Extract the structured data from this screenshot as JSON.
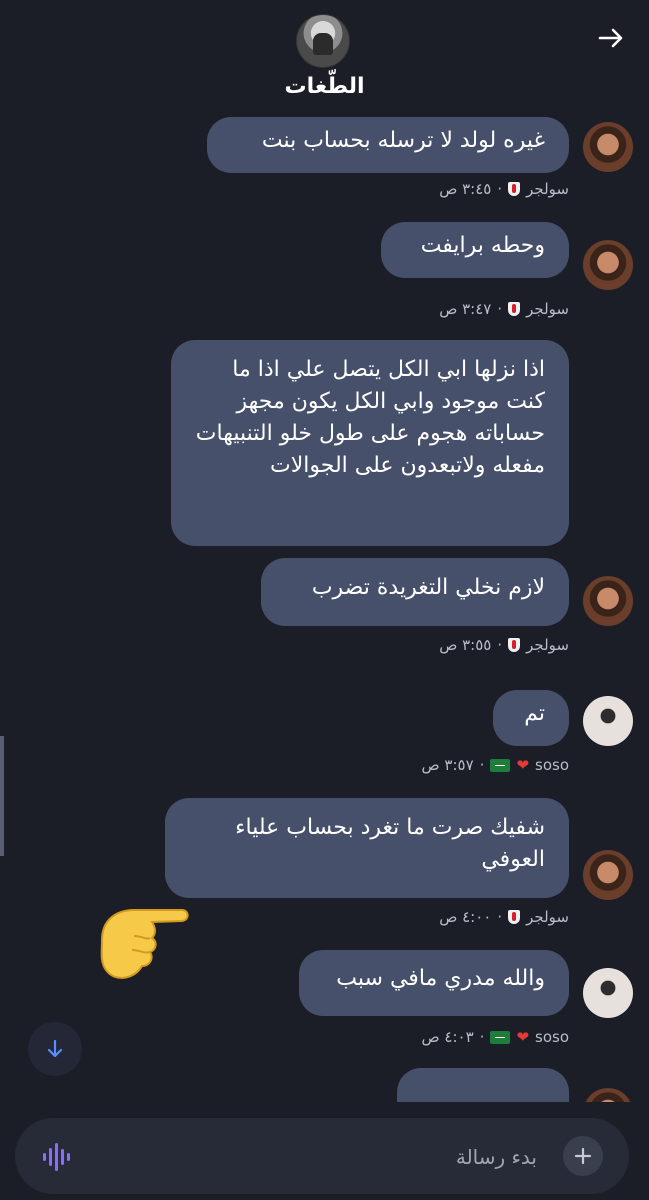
{
  "header": {
    "title": "الطّغات"
  },
  "messages": [
    {
      "text": "غيره لولد لا ترسله بحساب بنت",
      "sender": "سولجر",
      "time": "٣:٤٥ ص"
    },
    {
      "text": "وحطه برايفت",
      "sender": "سولجر",
      "time": "٣:٤٧ ص"
    },
    {
      "text": "اذا نزلها ابي الكل يتصل علي اذا ما كنت موجود وابي الكل يكون مجهز حساباته هجوم على طول خلو التنبيهات مفعله ولاتبعدون على الجوالات"
    },
    {
      "text": "لازم نخلي التغريدة تضرب",
      "sender": "سولجر",
      "time": "٣:٥٥ ص"
    },
    {
      "text": "تم",
      "sender": "soso",
      "time": "٣:٥٧ ص"
    },
    {
      "text": "شفيك صرت ما تغرد بحساب علياء العوفي",
      "sender": "سولجر",
      "time": "٤:٠٠ ص"
    },
    {
      "text": "والله مدري مافي سبب",
      "sender": "soso",
      "time": "٤:٠٣ ص"
    }
  ],
  "composer": {
    "placeholder": "بدء رسالة"
  },
  "icons": {
    "back": "arrow-right-icon",
    "plus": "plus-icon",
    "voice": "voice-wave-icon",
    "scroll": "arrow-down-icon",
    "reaction": "pointing-hand-emoji"
  },
  "colors": {
    "background": "#1b1e27",
    "bubble": "#47506a",
    "meta_text": "#b9bccb",
    "accent_voice": "#8b6cff"
  }
}
